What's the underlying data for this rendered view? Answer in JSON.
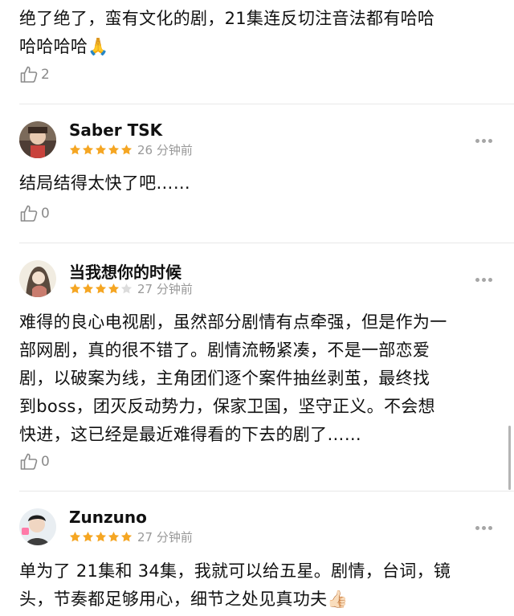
{
  "top_comment": {
    "lines": [
      "绝了绝了，蛮有文化的剧，21集连反切注音法都有哈哈",
      "哈哈哈哈🙏"
    ],
    "likes": "2"
  },
  "reviews": [
    {
      "name": "Saber TSK",
      "time": "26 分钟前",
      "rating": 5,
      "lines": [
        "结局结得太快了吧……"
      ],
      "likes": "0"
    },
    {
      "name": "当我想你的时候",
      "time": "27 分钟前",
      "rating": 4,
      "lines": [
        "难得的良心电视剧，虽然部分剧情有点牵强，但是作为一",
        "部网剧，真的很不错了。剧情流畅紧凑，不是一部恋爱",
        "剧，以破案为线，主角团们逐个案件抽丝剥茧，最终找",
        "到boss，团灭反动势力，保家卫国，坚守正义。不会想",
        "快进，这已经是最近难得看的下去的剧了……"
      ],
      "likes": "0"
    },
    {
      "name": "Zunzuno",
      "time": "27 分钟前",
      "rating": 5,
      "lines": [
        "单为了 21集和 34集，我就可以给五星。剧情，台词，镜",
        "头，节奏都足够用心，细节之处见真功夫👍🏻"
      ]
    }
  ],
  "colors": {
    "star_on": "#f5a623",
    "star_off": "#dcdcdc",
    "meta": "#999999"
  },
  "icons": {
    "like": "thumbs-up-icon",
    "more": "more-dots-icon"
  }
}
